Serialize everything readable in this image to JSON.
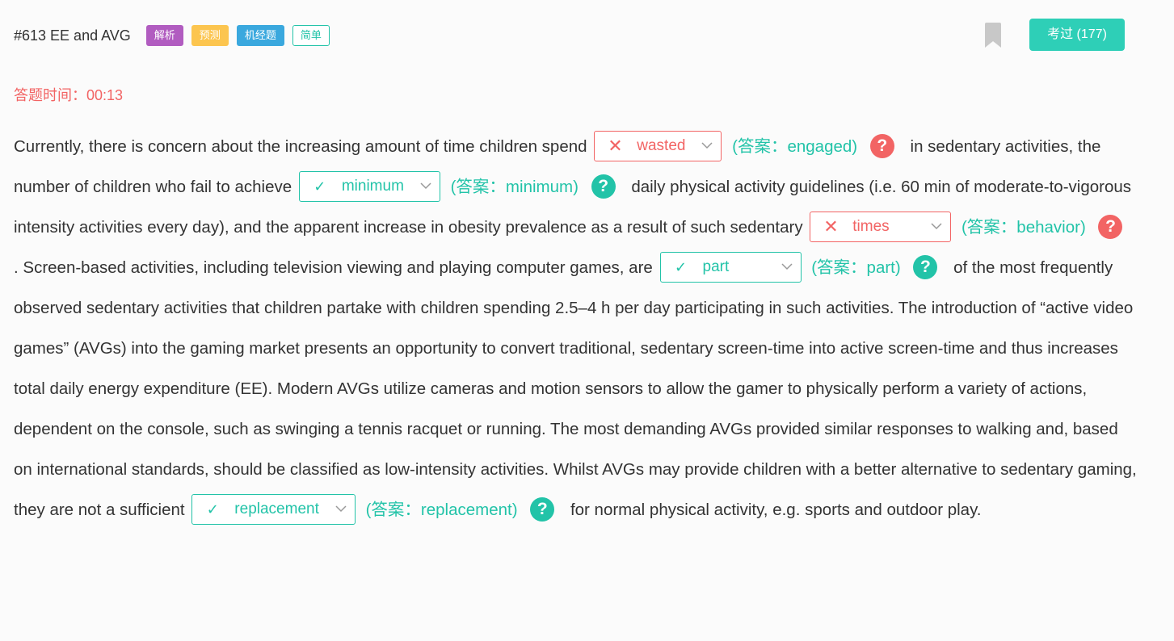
{
  "header": {
    "title": "#613 EE and AVG",
    "tags": [
      "解析",
      "预测",
      "机经题",
      "简单"
    ],
    "passed_button": "考过 (177)"
  },
  "timer": "答题时间：00:13",
  "passage": {
    "seg0": "Currently, there is concern about the increasing amount of time children spend",
    "seg1": "in sedentary activities, the number of children who fail to achieve",
    "seg2": "daily physical activity guidelines (i.e. 60 min of moderate-to-vigorous intensity activities every day), and the apparent increase in obesity prevalence as a result of such sedentary",
    "seg3": ". Screen-based activities, including television viewing and playing computer games, are",
    "seg4": "of the most frequently observed sedentary activities that children partake with children spending 2.5–4 h per day participating in such activities. The introduction of “active video games” (AVGs) into the gaming market presents an opportunity to convert traditional, sedentary screen-time into active screen-time and thus increases total daily energy expenditure (EE). Modern AVGs utilize cameras and motion sensors to allow the gamer to physically perform a variety of actions, dependent on the console, such as swinging a tennis racquet or running. The most demanding AVGs provided similar responses to walking and, based on international standards, should be classified as low-intensity activities. Whilst AVGs may provide children with a better alternative to sedentary gaming, they are not a sufficient",
    "seg5": "for normal physical activity, e.g. sports and outdoor play."
  },
  "blanks": [
    {
      "selected": "wasted",
      "answer": "(答案：engaged)",
      "mark": "✕",
      "status": "wrong"
    },
    {
      "selected": "minimum",
      "answer": "(答案：minimum)",
      "mark": "✓",
      "status": "correct"
    },
    {
      "selected": "times",
      "answer": "(答案：behavior)",
      "mark": "✕",
      "status": "wrong"
    },
    {
      "selected": "part",
      "answer": "(答案：part)",
      "mark": "✓",
      "status": "correct"
    },
    {
      "selected": "replacement",
      "answer": "(答案：replacement)",
      "mark": "✓",
      "status": "correct"
    }
  ],
  "help_glyph": "?",
  "icons": {
    "bookmark": "bookmark-icon",
    "chevron": "chevron-down-icon",
    "help": "help-circle-icon"
  },
  "colors": {
    "accent": "#22c3a8",
    "error": "#f26464",
    "button": "#2ecfb7"
  }
}
